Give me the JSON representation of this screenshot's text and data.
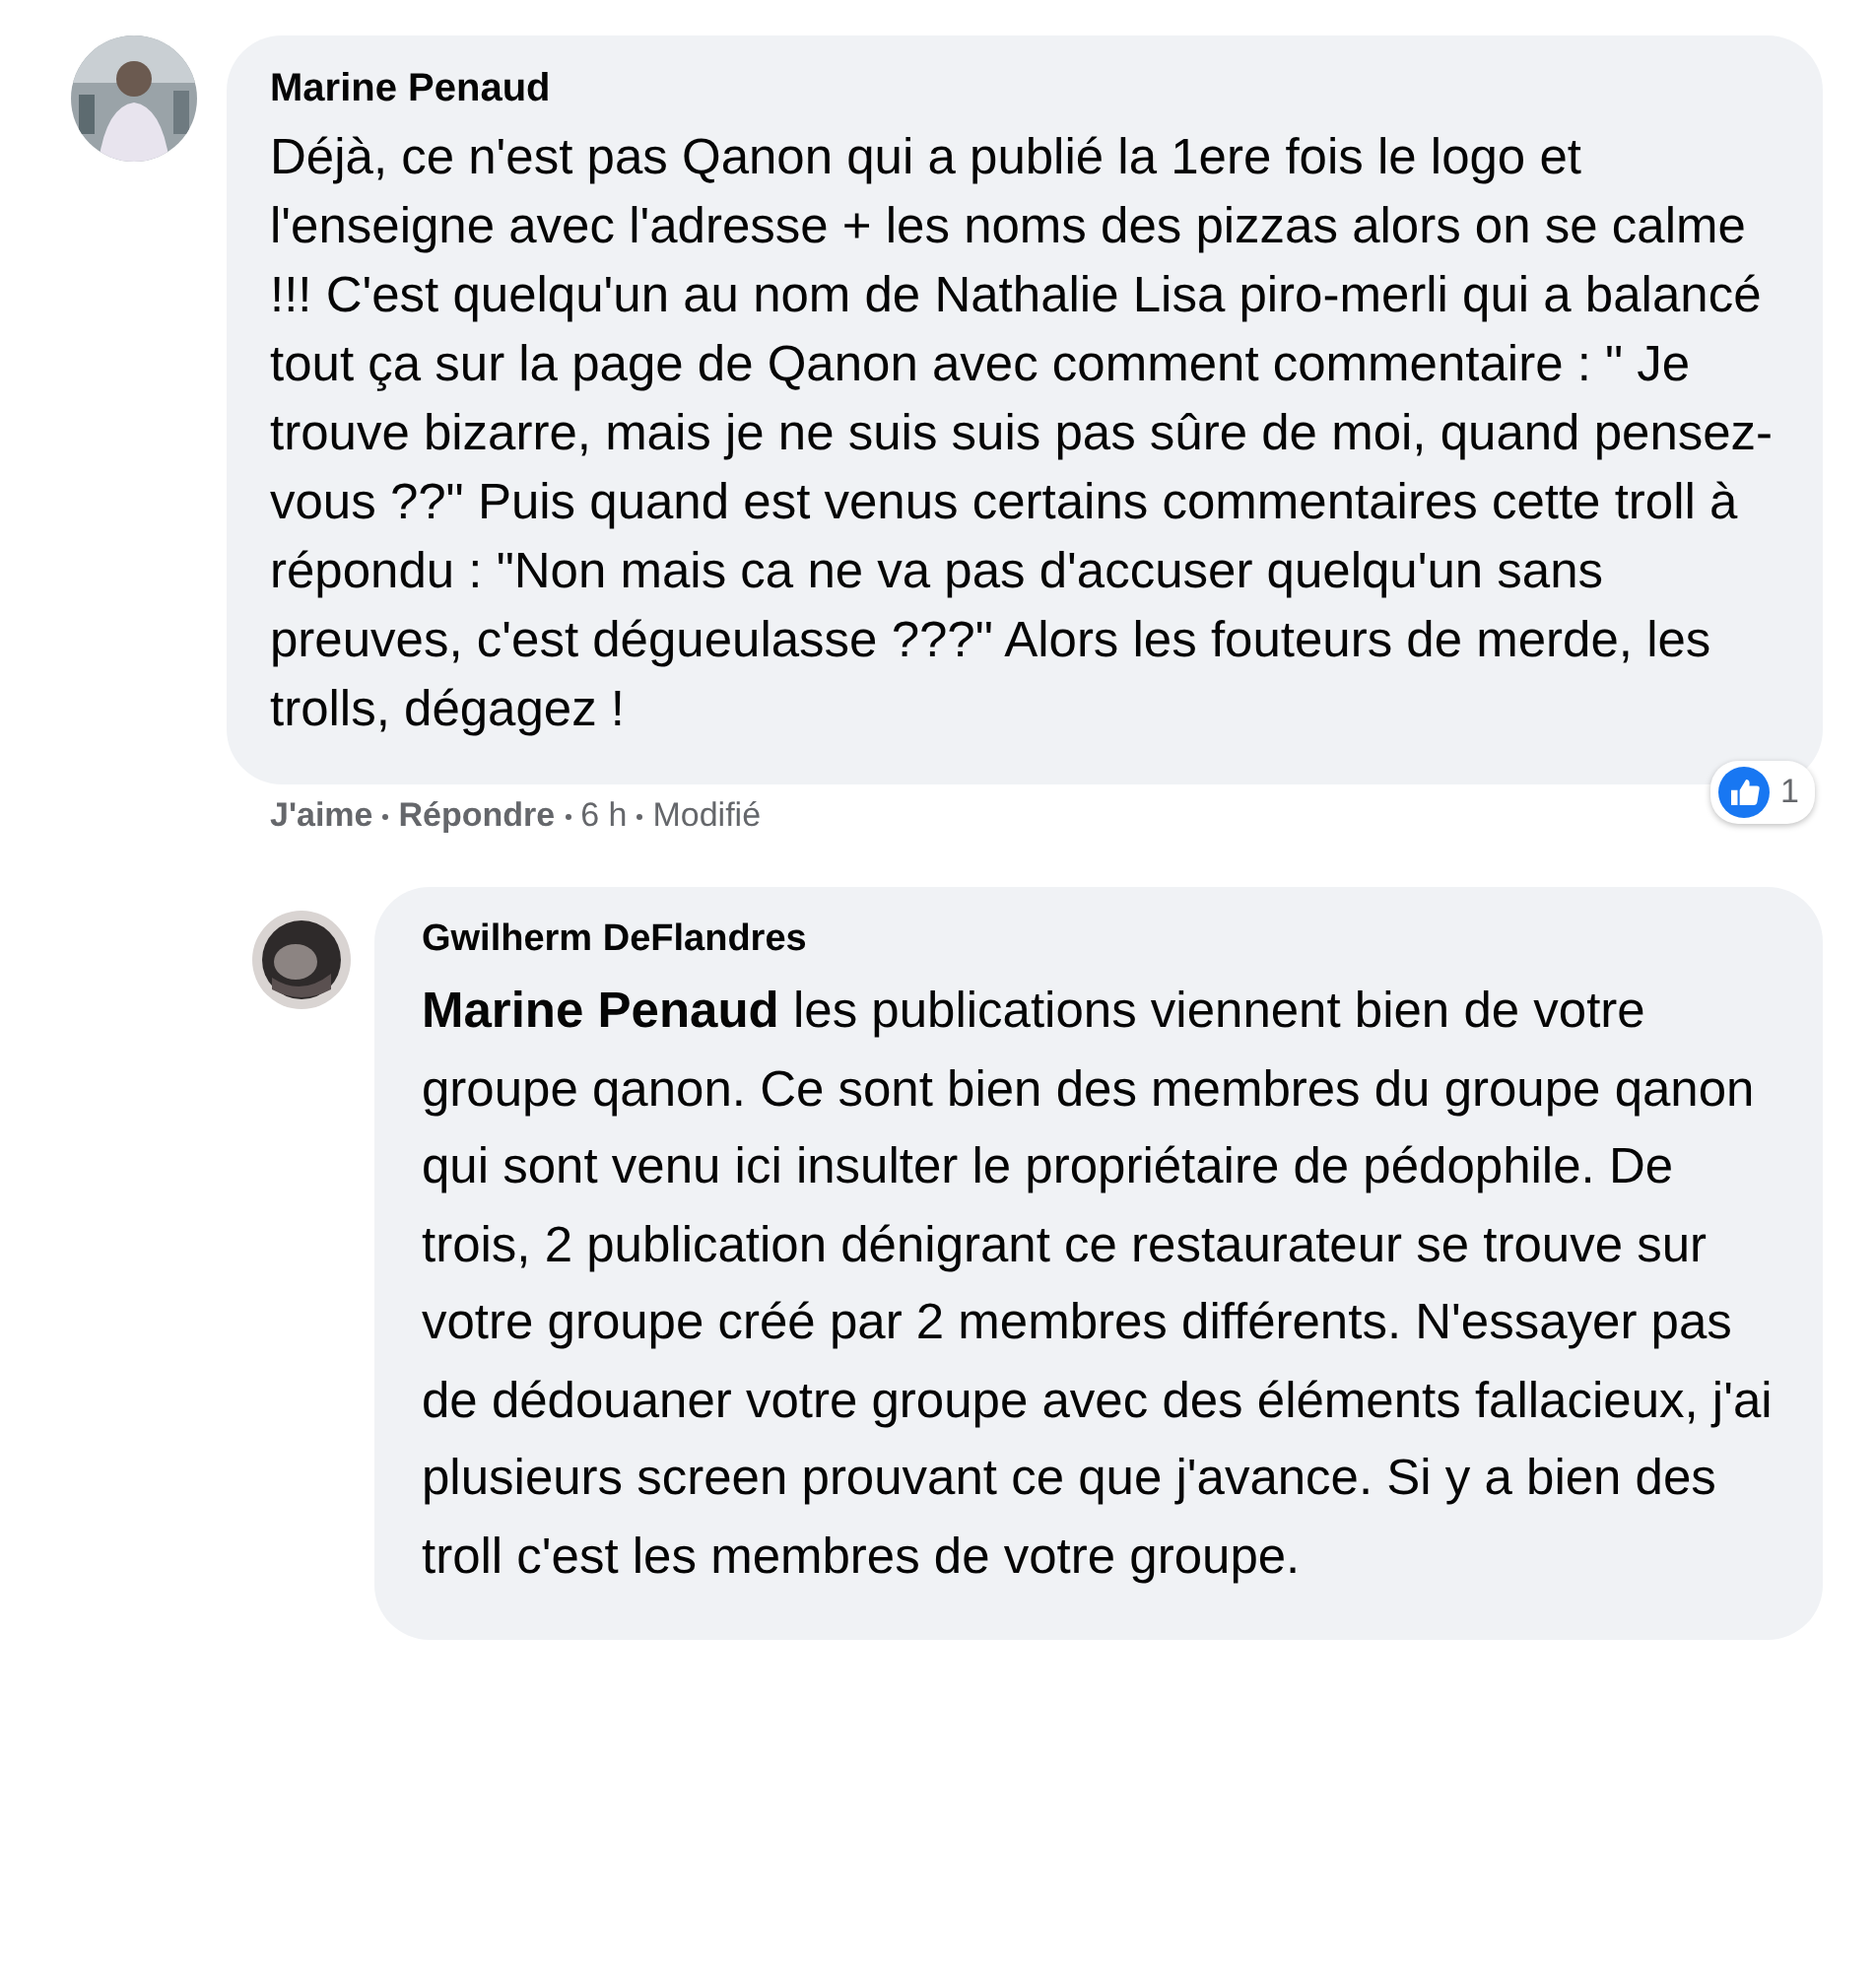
{
  "comments": [
    {
      "author": "Marine Penaud",
      "body": "Déjà, ce n'est pas Qanon qui a publié la 1ere fois le logo et l'enseigne avec l'adresse + les noms des pizzas alors on se calme !!! C'est quelqu'un au nom de Nathalie Lisa piro-merli qui a balancé tout ça sur la page de Qanon avec comment commentaire : \" Je trouve bizarre, mais je ne suis suis pas sûre de moi, quand pensez-vous ??\" Puis quand est venus certains commentaires cette troll à répondu : \"Non mais ca ne va pas d'accuser quelqu'un sans preuves, c'est dégueulasse ???\" Alors les fouteurs de merde, les trolls, dégagez !",
      "reaction_count": "1",
      "actions": [
        {
          "label": "J'aime",
          "kind": "link"
        },
        {
          "label": "Répondre",
          "kind": "link"
        },
        {
          "label": "6 h",
          "kind": "time"
        },
        {
          "label": "Modifié",
          "kind": "note"
        }
      ],
      "replies": [
        {
          "author": "Gwilherm DeFlandres",
          "body": "**Marine Penaud** les publications viennent bien de votre groupe qanon. Ce sont bien des membres du groupe qanon qui sont venu ici insulter le propriétaire de pédophile. De trois, 2 publication dénigrant ce restaurateur se trouve sur votre groupe créé par 2 membres différents. N'essayer pas de dédouaner votre groupe avec des éléments fallacieux, j'ai plusieurs screen prouvant ce que j'avance. Si y a bien des troll c'est les membres de votre groupe."
        }
      ]
    }
  ]
}
